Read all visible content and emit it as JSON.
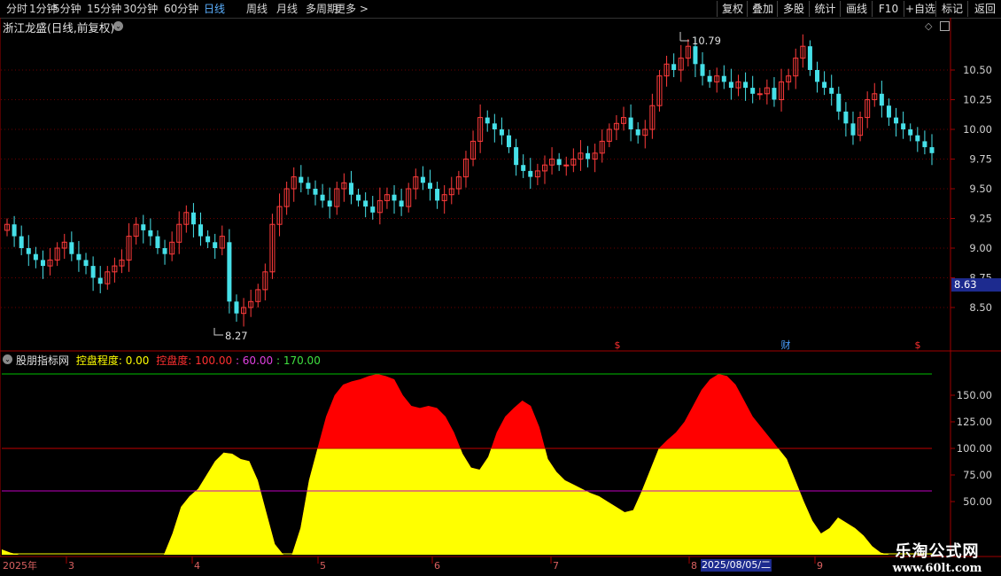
{
  "toolbar": {
    "tabs": [
      "分时",
      "1分钟",
      "5分钟",
      "15分钟",
      "30分钟",
      "60分钟",
      "日线",
      "周线",
      "月线",
      "多周期",
      "更多 >"
    ],
    "active_tab": "日线",
    "right_buttons": [
      "复权",
      "叠加",
      "多股",
      "统计",
      "画线",
      "F10",
      "+自选",
      "标记",
      "返回"
    ]
  },
  "stock": {
    "title": "浙江龙盛(日线,前复权)"
  },
  "price_panel": {
    "y_labels": [
      "10.50",
      "10.25",
      "10.00",
      "9.75",
      "9.50",
      "9.25",
      "9.00",
      "8.75",
      "8.50"
    ],
    "high_label": "10.79",
    "low_label": "8.27",
    "current_price": "8.63",
    "markers": [
      "$",
      "财",
      "$"
    ]
  },
  "indicator": {
    "name": "股朋指标网",
    "label1": "控盘程度: 0.00",
    "label2": "控盘度: 100.00",
    "label3": ": 60.00",
    "label4": ": 170.00",
    "y_labels": [
      "150.00",
      "125.00",
      "100.00",
      "75.00",
      "50.00"
    ],
    "colors": {
      "yellow": "#ffff00",
      "red": "#ff0000",
      "line170": "#00c000",
      "line100": "#c00000",
      "line60": "#c000c0"
    }
  },
  "x_axis": {
    "labels": [
      "2025年",
      "3",
      "4",
      "5",
      "6",
      "7",
      "8",
      "9"
    ],
    "date_box": "2025/08/05/二"
  },
  "watermark": {
    "line1": "乐淘公式网",
    "line2": "www.60lt.com"
  },
  "chart_data": {
    "type": "candlestick",
    "price_ylim": [
      8.27,
      10.79
    ],
    "indicator_ylim": [
      0,
      170
    ],
    "closes": [
      9.2,
      9.1,
      9.0,
      8.95,
      8.9,
      8.85,
      8.9,
      9.0,
      9.05,
      8.95,
      8.9,
      8.85,
      8.75,
      8.7,
      8.8,
      8.85,
      8.9,
      9.1,
      9.2,
      9.15,
      9.1,
      9.0,
      8.95,
      9.05,
      9.2,
      9.3,
      9.2,
      9.1,
      9.05,
      9.0,
      9.1,
      8.55,
      8.45,
      8.5,
      8.55,
      8.65,
      8.8,
      9.2,
      9.35,
      9.5,
      9.6,
      9.55,
      9.5,
      9.45,
      9.4,
      9.35,
      9.5,
      9.55,
      9.45,
      9.4,
      9.35,
      9.3,
      9.4,
      9.45,
      9.4,
      9.35,
      9.5,
      9.6,
      9.55,
      9.5,
      9.4,
      9.45,
      9.5,
      9.6,
      9.75,
      9.9,
      10.1,
      10.05,
      10.0,
      9.95,
      9.85,
      9.7,
      9.65,
      9.6,
      9.65,
      9.7,
      9.75,
      9.7,
      9.7,
      9.75,
      9.8,
      9.75,
      9.8,
      9.9,
      10.0,
      10.05,
      10.1,
      10.0,
      9.95,
      10.0,
      10.2,
      10.45,
      10.55,
      10.5,
      10.6,
      10.7,
      10.55,
      10.45,
      10.4,
      10.45,
      10.4,
      10.35,
      10.4,
      10.35,
      10.3,
      10.3,
      10.35,
      10.25,
      10.4,
      10.45,
      10.6,
      10.7,
      10.5,
      10.4,
      10.35,
      10.3,
      10.15,
      10.05,
      9.95,
      10.1,
      10.25,
      10.3,
      10.2,
      10.1,
      10.05,
      10.0,
      9.95,
      9.9,
      9.85,
      9.8
    ],
    "opens": [
      9.15,
      9.2,
      9.1,
      9.0,
      8.95,
      8.9,
      8.85,
      8.9,
      9.0,
      9.05,
      8.95,
      8.9,
      8.85,
      8.75,
      8.7,
      8.8,
      8.85,
      8.9,
      9.1,
      9.2,
      9.15,
      9.1,
      9.0,
      8.95,
      9.05,
      9.2,
      9.3,
      9.2,
      9.1,
      9.05,
      9.0,
      9.05,
      8.55,
      8.45,
      8.5,
      8.55,
      8.65,
      8.8,
      9.2,
      9.35,
      9.5,
      9.6,
      9.55,
      9.5,
      9.45,
      9.4,
      9.35,
      9.5,
      9.55,
      9.45,
      9.4,
      9.35,
      9.3,
      9.4,
      9.45,
      9.4,
      9.35,
      9.5,
      9.6,
      9.55,
      9.5,
      9.4,
      9.45,
      9.5,
      9.6,
      9.75,
      9.9,
      10.1,
      10.05,
      10.0,
      9.95,
      9.85,
      9.7,
      9.65,
      9.6,
      9.65,
      9.7,
      9.75,
      9.7,
      9.7,
      9.75,
      9.8,
      9.75,
      9.8,
      9.9,
      10.0,
      10.05,
      10.1,
      10.0,
      9.95,
      10.0,
      10.2,
      10.45,
      10.55,
      10.5,
      10.6,
      10.7,
      10.55,
      10.45,
      10.4,
      10.45,
      10.4,
      10.35,
      10.4,
      10.35,
      10.3,
      10.3,
      10.35,
      10.25,
      10.4,
      10.45,
      10.6,
      10.7,
      10.5,
      10.4,
      10.35,
      10.3,
      10.15,
      10.05,
      9.95,
      10.1,
      10.25,
      10.3,
      10.2,
      10.1,
      10.05,
      10.0,
      9.95,
      9.9,
      9.85
    ],
    "control_degree": [
      5,
      2,
      0,
      0,
      0,
      0,
      0,
      0,
      0,
      0,
      0,
      0,
      0,
      0,
      0,
      0,
      0,
      0,
      0,
      0,
      20,
      45,
      55,
      62,
      75,
      88,
      96,
      95,
      90,
      88,
      70,
      40,
      10,
      0,
      0,
      25,
      70,
      100,
      130,
      150,
      160,
      163,
      165,
      168,
      170,
      168,
      165,
      150,
      140,
      138,
      140,
      138,
      130,
      115,
      95,
      82,
      80,
      92,
      115,
      130,
      138,
      145,
      140,
      120,
      90,
      78,
      70,
      66,
      62,
      58,
      55,
      50,
      45,
      40,
      42,
      60,
      80,
      100,
      108,
      115,
      125,
      140,
      155,
      165,
      170,
      168,
      160,
      145,
      130,
      120,
      110,
      100,
      90,
      70,
      50,
      32,
      20,
      25,
      35,
      30,
      25,
      18,
      8,
      2,
      0,
      0,
      0,
      0,
      0,
      0
    ]
  }
}
